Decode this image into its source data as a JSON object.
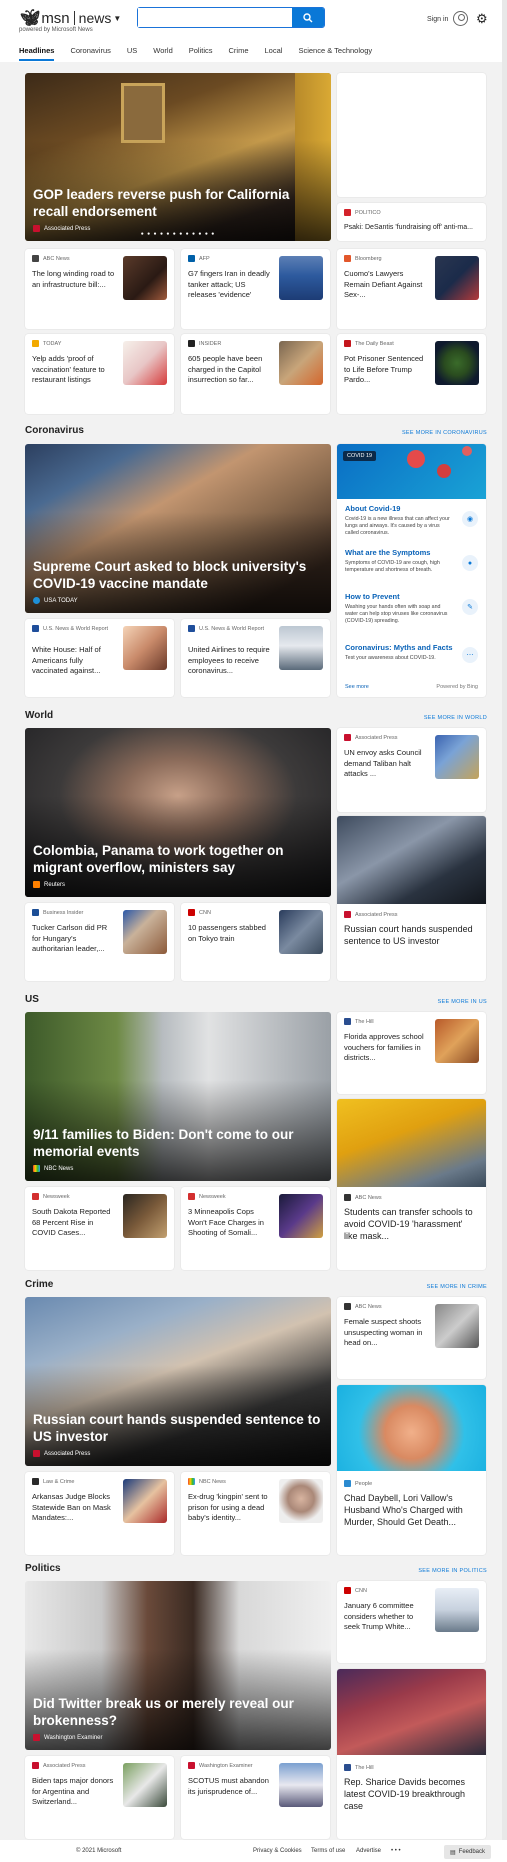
{
  "header": {
    "brand": "msn",
    "section": "news",
    "powered": "powered by Microsoft News",
    "search_placeholder": "",
    "signin": "Sign in"
  },
  "nav": [
    "Headlines",
    "Coronavirus",
    "US",
    "World",
    "Politics",
    "Crime",
    "Local",
    "Science & Technology"
  ],
  "headlines": {
    "hero": {
      "title": "GOP leaders reverse push for California recall endorsement",
      "source": "Associated Press"
    },
    "side_top": {
      "source": "POLITICO",
      "title": "Psaki: DeSantis 'fundraising off' anti-ma..."
    },
    "row1": [
      {
        "source": "ABC News",
        "title": "The long winding road to an infrastructure bill:..."
      },
      {
        "source": "AFP",
        "title": "G7 fingers Iran in deadly tanker attack; US releases 'evidence'"
      },
      {
        "source": "Bloomberg",
        "title": "Cuomo's Lawyers Remain Defiant Against Sex-..."
      }
    ],
    "row2": [
      {
        "source": "TODAY",
        "title": "Yelp adds 'proof of vaccination' feature to restaurant listings"
      },
      {
        "source": "INSIDER",
        "title": "605 people have been charged in the Capitol insurrection so far..."
      },
      {
        "source": "The Daily Beast",
        "title": "Pot Prisoner Sentenced to Life Before Trump Pardo..."
      }
    ]
  },
  "coronavirus": {
    "heading": "Coronavirus",
    "more": "SEE MORE IN CORONAVIRUS",
    "hero": {
      "title": "Supreme Court asked to block university's COVID-19 vaccine mandate",
      "source": "USA TODAY"
    },
    "panel": {
      "pill": "COVID 19",
      "items": [
        {
          "title": "About Covid-19",
          "text": "Covid-19 is a new illness that can affect your lungs and airways. It's caused by a virus called coronavirus."
        },
        {
          "title": "What are the Symptoms",
          "text": "Symptoms of COVID-19 are cough, high temperature and shortness of breath."
        },
        {
          "title": "How to Prevent",
          "text": "Washing your hands often with soap and water can help stop viruses like coronavirus (COVID-19) spreading."
        },
        {
          "title": "Coronavirus: Myths and Facts",
          "text": "Test your awareness about COVID-19."
        }
      ],
      "see_more": "See more",
      "powered": "Powered by Bing"
    },
    "row": [
      {
        "source": "U.S. News & World Report",
        "title": "White House: Half of Americans fully vaccinated against..."
      },
      {
        "source": "U.S. News & World Report",
        "title": "United Airlines to require employees to receive coronavirus..."
      }
    ]
  },
  "world": {
    "heading": "World",
    "more": "SEE MORE IN WORLD",
    "hero": {
      "title": "Colombia, Panama to work together on migrant overflow, ministers say",
      "source": "Reuters"
    },
    "side_small": {
      "source": "Associated Press",
      "title": "UN envoy asks Council demand Taliban halt attacks ..."
    },
    "side_tall": {
      "source": "Associated Press",
      "title": "Russian court hands suspended sentence to US investor"
    },
    "row": [
      {
        "source": "Business Insider",
        "title": "Tucker Carlson did PR for Hungary's authoritarian leader,..."
      },
      {
        "source": "CNN",
        "title": "10 passengers stabbed on Tokyo train"
      }
    ]
  },
  "us": {
    "heading": "US",
    "more": "SEE MORE IN US",
    "hero": {
      "title": "9/11 families to Biden: Don't come to our memorial events",
      "source": "NBC News"
    },
    "side_small": {
      "source": "The Hill",
      "title": "Florida approves school vouchers for families in districts..."
    },
    "side_tall": {
      "source": "ABC News",
      "title": "Students can transfer schools to avoid COVID-19 'harassment' like mask..."
    },
    "row": [
      {
        "source": "Newsweek",
        "title": "South Dakota Reported 68 Percent Rise in COVID Cases..."
      },
      {
        "source": "Newsweek",
        "title": "3 Minneapolis Cops Won't Face Charges in Shooting of Somali..."
      }
    ]
  },
  "crime": {
    "heading": "Crime",
    "more": "SEE MORE IN CRIME",
    "hero": {
      "title": "Russian court hands suspended sentence to US investor",
      "source": "Associated Press"
    },
    "side_small": {
      "source": "ABC News",
      "title": "Female suspect shoots unsuspecting woman in head on..."
    },
    "side_tall": {
      "source": "People",
      "title": "Chad Daybell, Lori Vallow's Husband Who's Charged with Murder, Should Get Death..."
    },
    "row": [
      {
        "source": "Law & Crime",
        "title": "Arkansas Judge Blocks Statewide Ban on Mask Mandates:..."
      },
      {
        "source": "NBC News",
        "title": "Ex-drug 'kingpin' sent to prison for using a dead baby's identity..."
      }
    ]
  },
  "politics": {
    "heading": "Politics",
    "more": "SEE MORE IN POLITICS",
    "hero": {
      "title": "Did Twitter break us or merely reveal our brokenness?",
      "source": "Washington Examiner"
    },
    "side_small": {
      "source": "CNN",
      "title": "January 6 committee considers whether to seek Trump White..."
    },
    "side_tall": {
      "source": "The Hill",
      "title": "Rep. Sharice Davids becomes latest COVID-19 breakthrough case"
    },
    "row": [
      {
        "source": "Associated Press",
        "title": "Biden taps major donors for Argentina and Switzerland..."
      },
      {
        "source": "Washington Examiner",
        "title": "SCOTUS must abandon its jurisprudence of..."
      }
    ]
  },
  "footer": {
    "copyright": "© 2021 Microsoft",
    "links": [
      "Privacy & Cookies",
      "Terms of use",
      "Advertise"
    ],
    "more": "• • •",
    "feedback": "Feedback"
  }
}
